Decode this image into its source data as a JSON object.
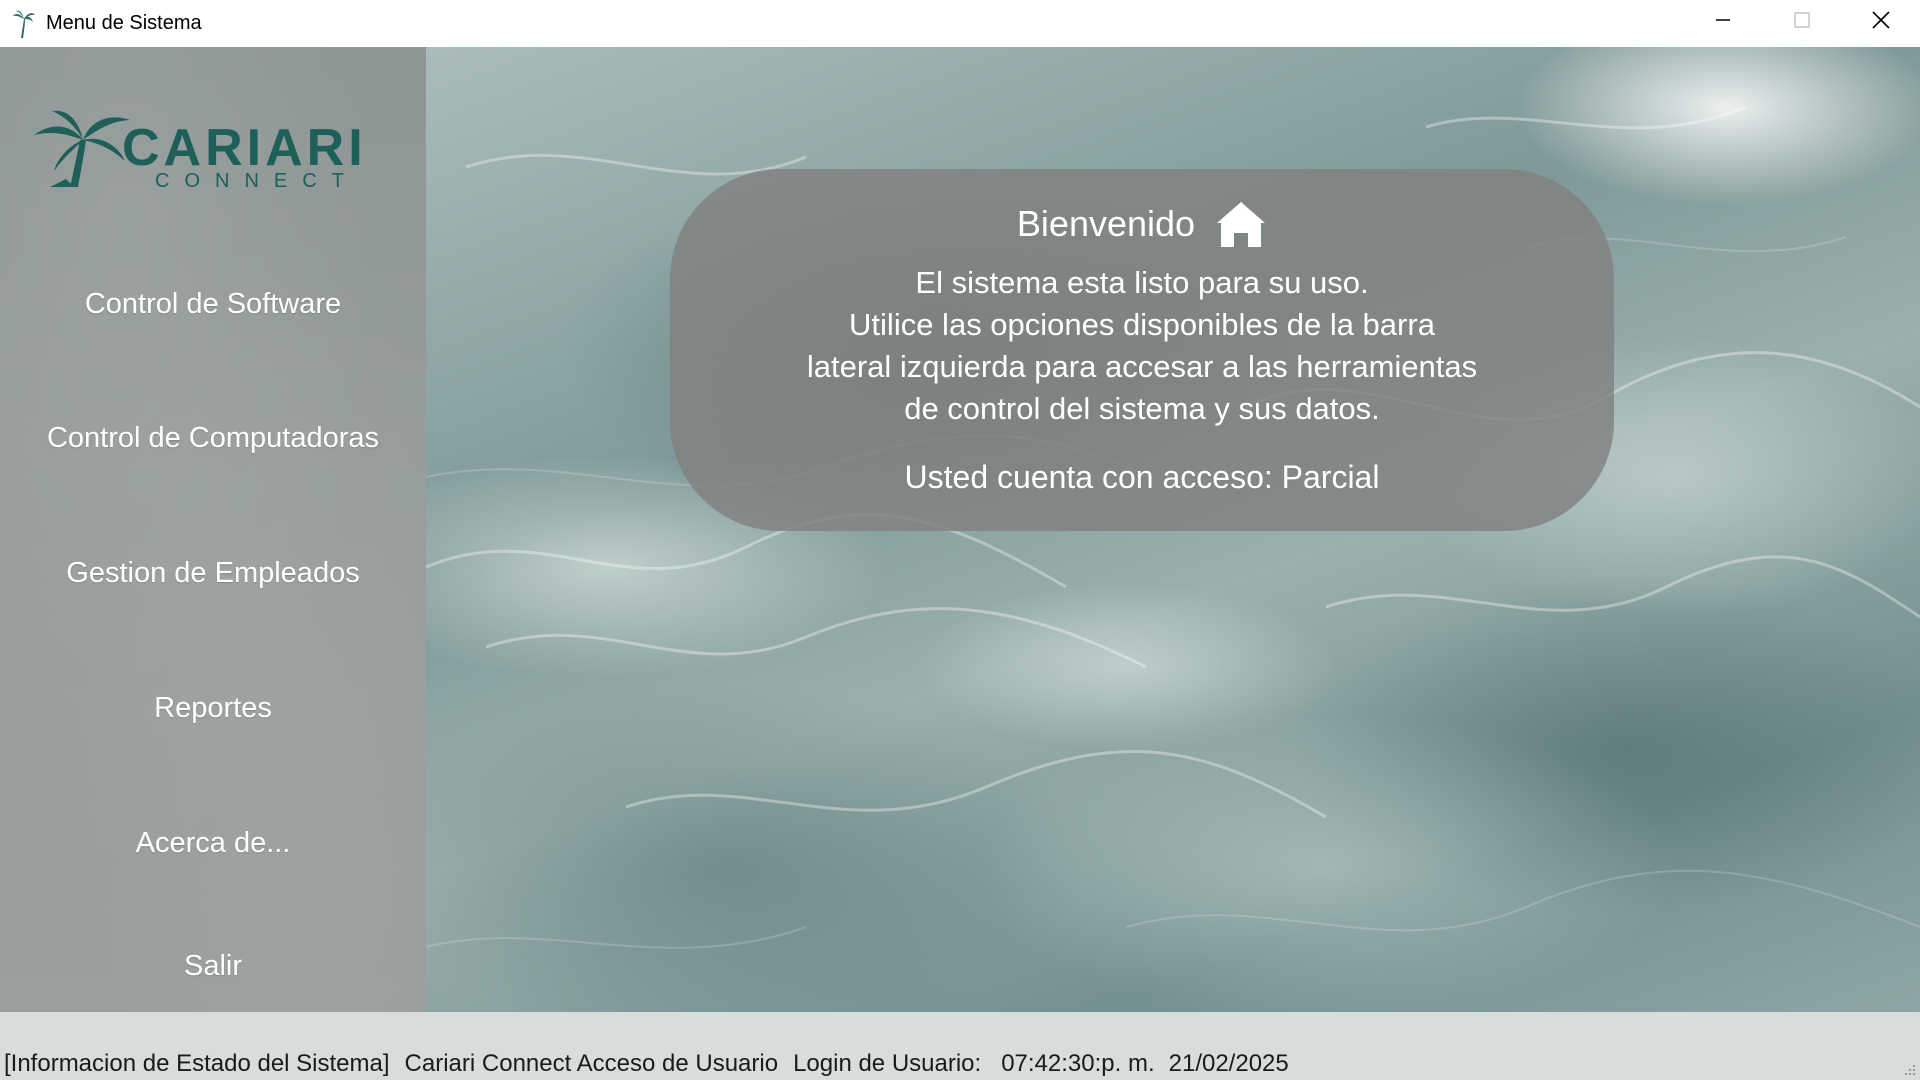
{
  "window": {
    "title": "Menu de Sistema",
    "icon": "palm-tree-icon"
  },
  "titlebar_controls": {
    "minimize": "minimize-icon",
    "maximize": "maximize-icon",
    "close": "close-icon"
  },
  "brand": {
    "name": "CARIARI",
    "tagline": "CONNECT",
    "color": "#1f5f5a"
  },
  "sidebar": {
    "items": [
      {
        "label": "Control de Software"
      },
      {
        "label": "Control de Computadoras"
      },
      {
        "label": "Gestion de Empleados"
      },
      {
        "label": "Reportes"
      },
      {
        "label": "Acerca de..."
      },
      {
        "label": "Salir"
      }
    ]
  },
  "welcome": {
    "title": "Bienvenido",
    "icon": "home-icon",
    "lines": [
      "El sistema esta listo para su uso.",
      "Utilice las opciones disponibles de la barra",
      "lateral izquierda para accesar a las herramientas",
      "de control del sistema y sus datos."
    ],
    "access": "Usted cuenta con acceso: Parcial"
  },
  "status": {
    "section": "[Informacion de Estado del Sistema]",
    "app": "Cariari Connect Acceso de Usuario",
    "login_label": "Login de Usuario:",
    "time": "07:42:30:p. m.",
    "date": "21/02/2025"
  }
}
